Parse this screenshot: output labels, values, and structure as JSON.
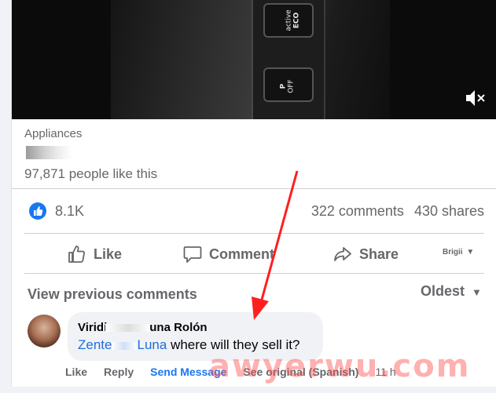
{
  "video": {
    "buttons": [
      {
        "line1": "active",
        "line2": "ECO"
      },
      {
        "line1": "P",
        "line2": "OFF"
      }
    ]
  },
  "page": {
    "category": "Appliances",
    "likes": "97,871 people like this"
  },
  "stats": {
    "reactions": "8.1K",
    "comments": "322 comments",
    "shares": "430 shares"
  },
  "actions": {
    "like": "Like",
    "comment": "Comment",
    "share": "Share",
    "profile": "Brigii"
  },
  "comments_section": {
    "view_previous": "View previous comments",
    "sort": "Oldest"
  },
  "comment": {
    "author_start": "Viridi",
    "author_end": "una Rolón",
    "mention_start": "Zente",
    "mention_end": "Luna",
    "text": " where will they sell it?",
    "like": "Like",
    "reply": "Reply",
    "send_message": "Send Message",
    "see_original": "See original (Spanish)",
    "time": "11 h"
  },
  "watermark": "awyerwu.com",
  "colors": {
    "accent": "#1877f2",
    "arrow": "#ff1f1f"
  }
}
